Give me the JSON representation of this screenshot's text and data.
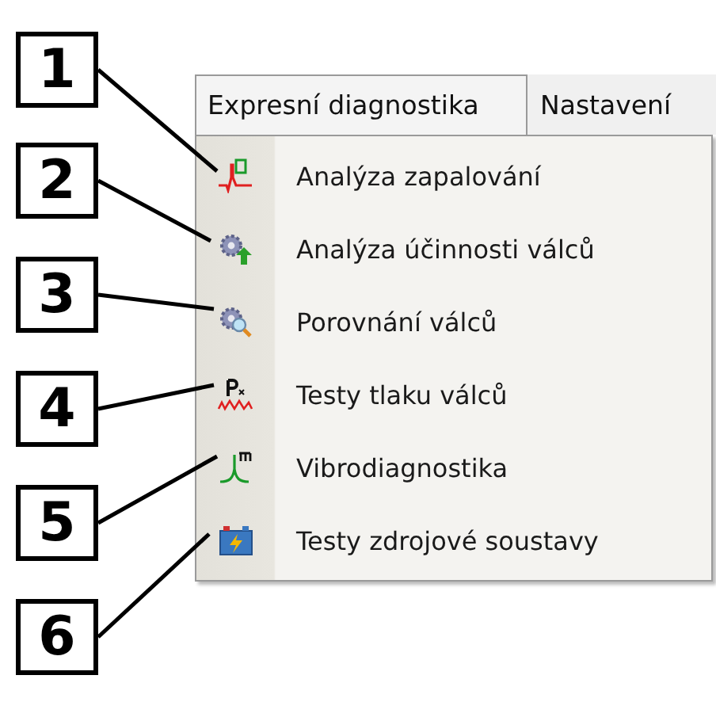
{
  "menu_bar": {
    "items": [
      {
        "label": "Expresní diagnostika",
        "selected": true
      },
      {
        "label": "Nastavení",
        "selected": false
      }
    ]
  },
  "menu": {
    "items": [
      {
        "label": "Analýza zapalování"
      },
      {
        "label": "Analýza účinnosti válců"
      },
      {
        "label": "Porovnání válců"
      },
      {
        "label": "Testy tlaku válců"
      },
      {
        "label": "Vibrodiagnostika"
      },
      {
        "label": "Testy zdrojové soustavy"
      }
    ]
  },
  "callouts": [
    {
      "number": "1"
    },
    {
      "number": "2"
    },
    {
      "number": "3"
    },
    {
      "number": "4"
    },
    {
      "number": "5"
    },
    {
      "number": "6"
    }
  ]
}
